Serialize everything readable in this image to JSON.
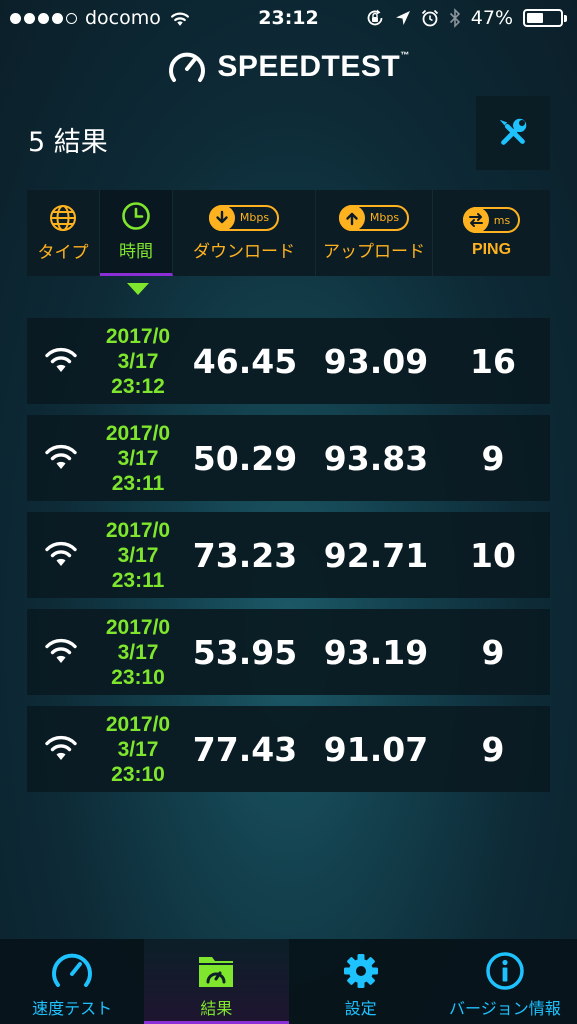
{
  "status_bar": {
    "carrier": "docomo",
    "time": "23:12",
    "battery": "47%",
    "battery_level": 0.47,
    "signal_bars_filled": 4,
    "signal_bars_total": 5
  },
  "header": {
    "app_name": "SPEEDTEST",
    "trademark": "™"
  },
  "results": {
    "count_label": "5 結果",
    "tools_icon": "tools-icon"
  },
  "sort_bar": {
    "columns": [
      {
        "label": "タイプ",
        "icon": "globe-icon"
      },
      {
        "label": "時間",
        "icon": "clock-icon",
        "active": true
      },
      {
        "label": "ダウンロード",
        "icon": "download-icon",
        "unit": "Mbps"
      },
      {
        "label": "アップロード",
        "icon": "upload-icon",
        "unit": "Mbps"
      },
      {
        "label": "PING",
        "icon": "ping-icon",
        "unit": "ms"
      }
    ]
  },
  "rows": [
    {
      "date_line1": "2017/0",
      "date_line2": "3/17",
      "time": "23:12",
      "download": "46.45",
      "upload": "93.09",
      "ping": "16"
    },
    {
      "date_line1": "2017/0",
      "date_line2": "3/17",
      "time": "23:11",
      "download": "50.29",
      "upload": "93.83",
      "ping": "9"
    },
    {
      "date_line1": "2017/0",
      "date_line2": "3/17",
      "time": "23:11",
      "download": "73.23",
      "upload": "92.71",
      "ping": "10"
    },
    {
      "date_line1": "2017/0",
      "date_line2": "3/17",
      "time": "23:10",
      "download": "53.95",
      "upload": "93.19",
      "ping": "9"
    },
    {
      "date_line1": "2017/0",
      "date_line2": "3/17",
      "time": "23:10",
      "download": "77.43",
      "upload": "91.07",
      "ping": "9"
    }
  ],
  "tab_bar": {
    "tabs": [
      {
        "label": "速度テスト",
        "icon": "speedometer-icon"
      },
      {
        "label": "結果",
        "icon": "results-folder-icon",
        "active": true
      },
      {
        "label": "設定",
        "icon": "gear-icon"
      },
      {
        "label": "バージョン情報",
        "icon": "info-icon"
      }
    ]
  },
  "colors": {
    "accent_green": "#7fe62d",
    "accent_orange": "#ffb21f",
    "accent_blue": "#1ec2ff",
    "active_purple": "#8b2ed6"
  }
}
